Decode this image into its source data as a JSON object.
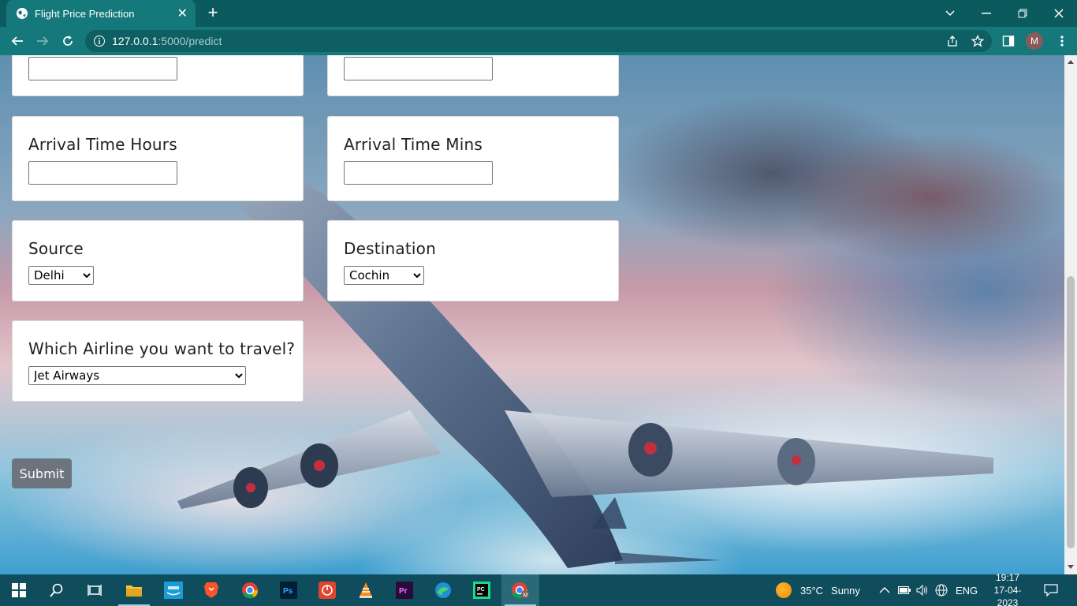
{
  "browser": {
    "tab_title": "Flight Price Prediction",
    "url_host": "127.0.0.1",
    "url_path": ":5000/predict",
    "profile_initial": "M"
  },
  "form": {
    "arrival_hours_label": "Arrival Time Hours",
    "arrival_hours_value": "",
    "arrival_mins_label": "Arrival Time Mins",
    "arrival_mins_value": "",
    "source_label": "Source",
    "source_value": "Delhi",
    "destination_label": "Destination",
    "destination_value": "Cochin",
    "airline_label": "Which Airline you want to travel?",
    "airline_value": "Jet Airways",
    "submit_label": "Submit"
  },
  "taskbar": {
    "weather_temp": "35°C",
    "weather_text": "Sunny",
    "language": "ENG",
    "time": "19:17",
    "date": "17-04-2023"
  },
  "colors": {
    "chrome_bg": "#0b5b5e",
    "toolbar_bg": "#15787a",
    "submit_bg": "#6c757d",
    "taskbar_bg": "#0f4c5c"
  }
}
